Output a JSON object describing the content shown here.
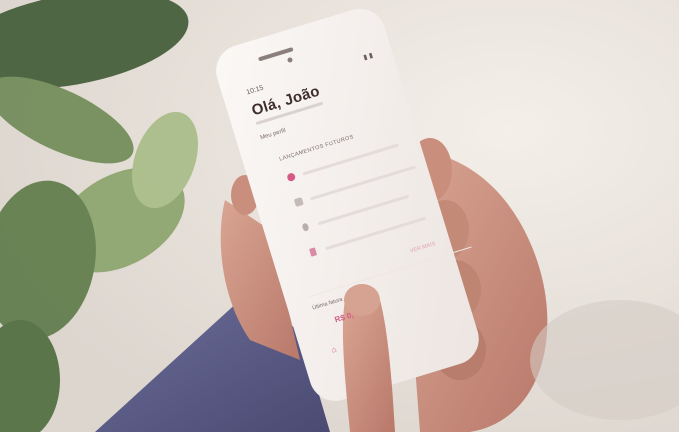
{
  "screen": {
    "status_time": "10:15",
    "status_icons": "▮ ▮",
    "greeting": "Olá, João",
    "profile_link": "Meu perfil",
    "section_title": "LANÇAMENTOS FUTUROS",
    "rows": [
      {
        "icon": "pink-dot-icon",
        "color": "#d65a86"
      },
      {
        "icon": "card-icon",
        "color": "#b9aeae"
      },
      {
        "icon": "phone-icon",
        "color": "#b9aeae"
      },
      {
        "icon": "document-icon",
        "color": "#d98aa4"
      }
    ],
    "more_link": "VER MAIS",
    "last_label": "Última fatura",
    "amount": "R$ 0,",
    "nav_home": "⌂"
  },
  "colors": {
    "accent": "#d65a86",
    "background_wall": "#e9e4df",
    "phone_body": "#f7f2ef",
    "skin": "#c98f7c",
    "plant": "#6f8a56",
    "sleeve": "#5a5b86"
  }
}
